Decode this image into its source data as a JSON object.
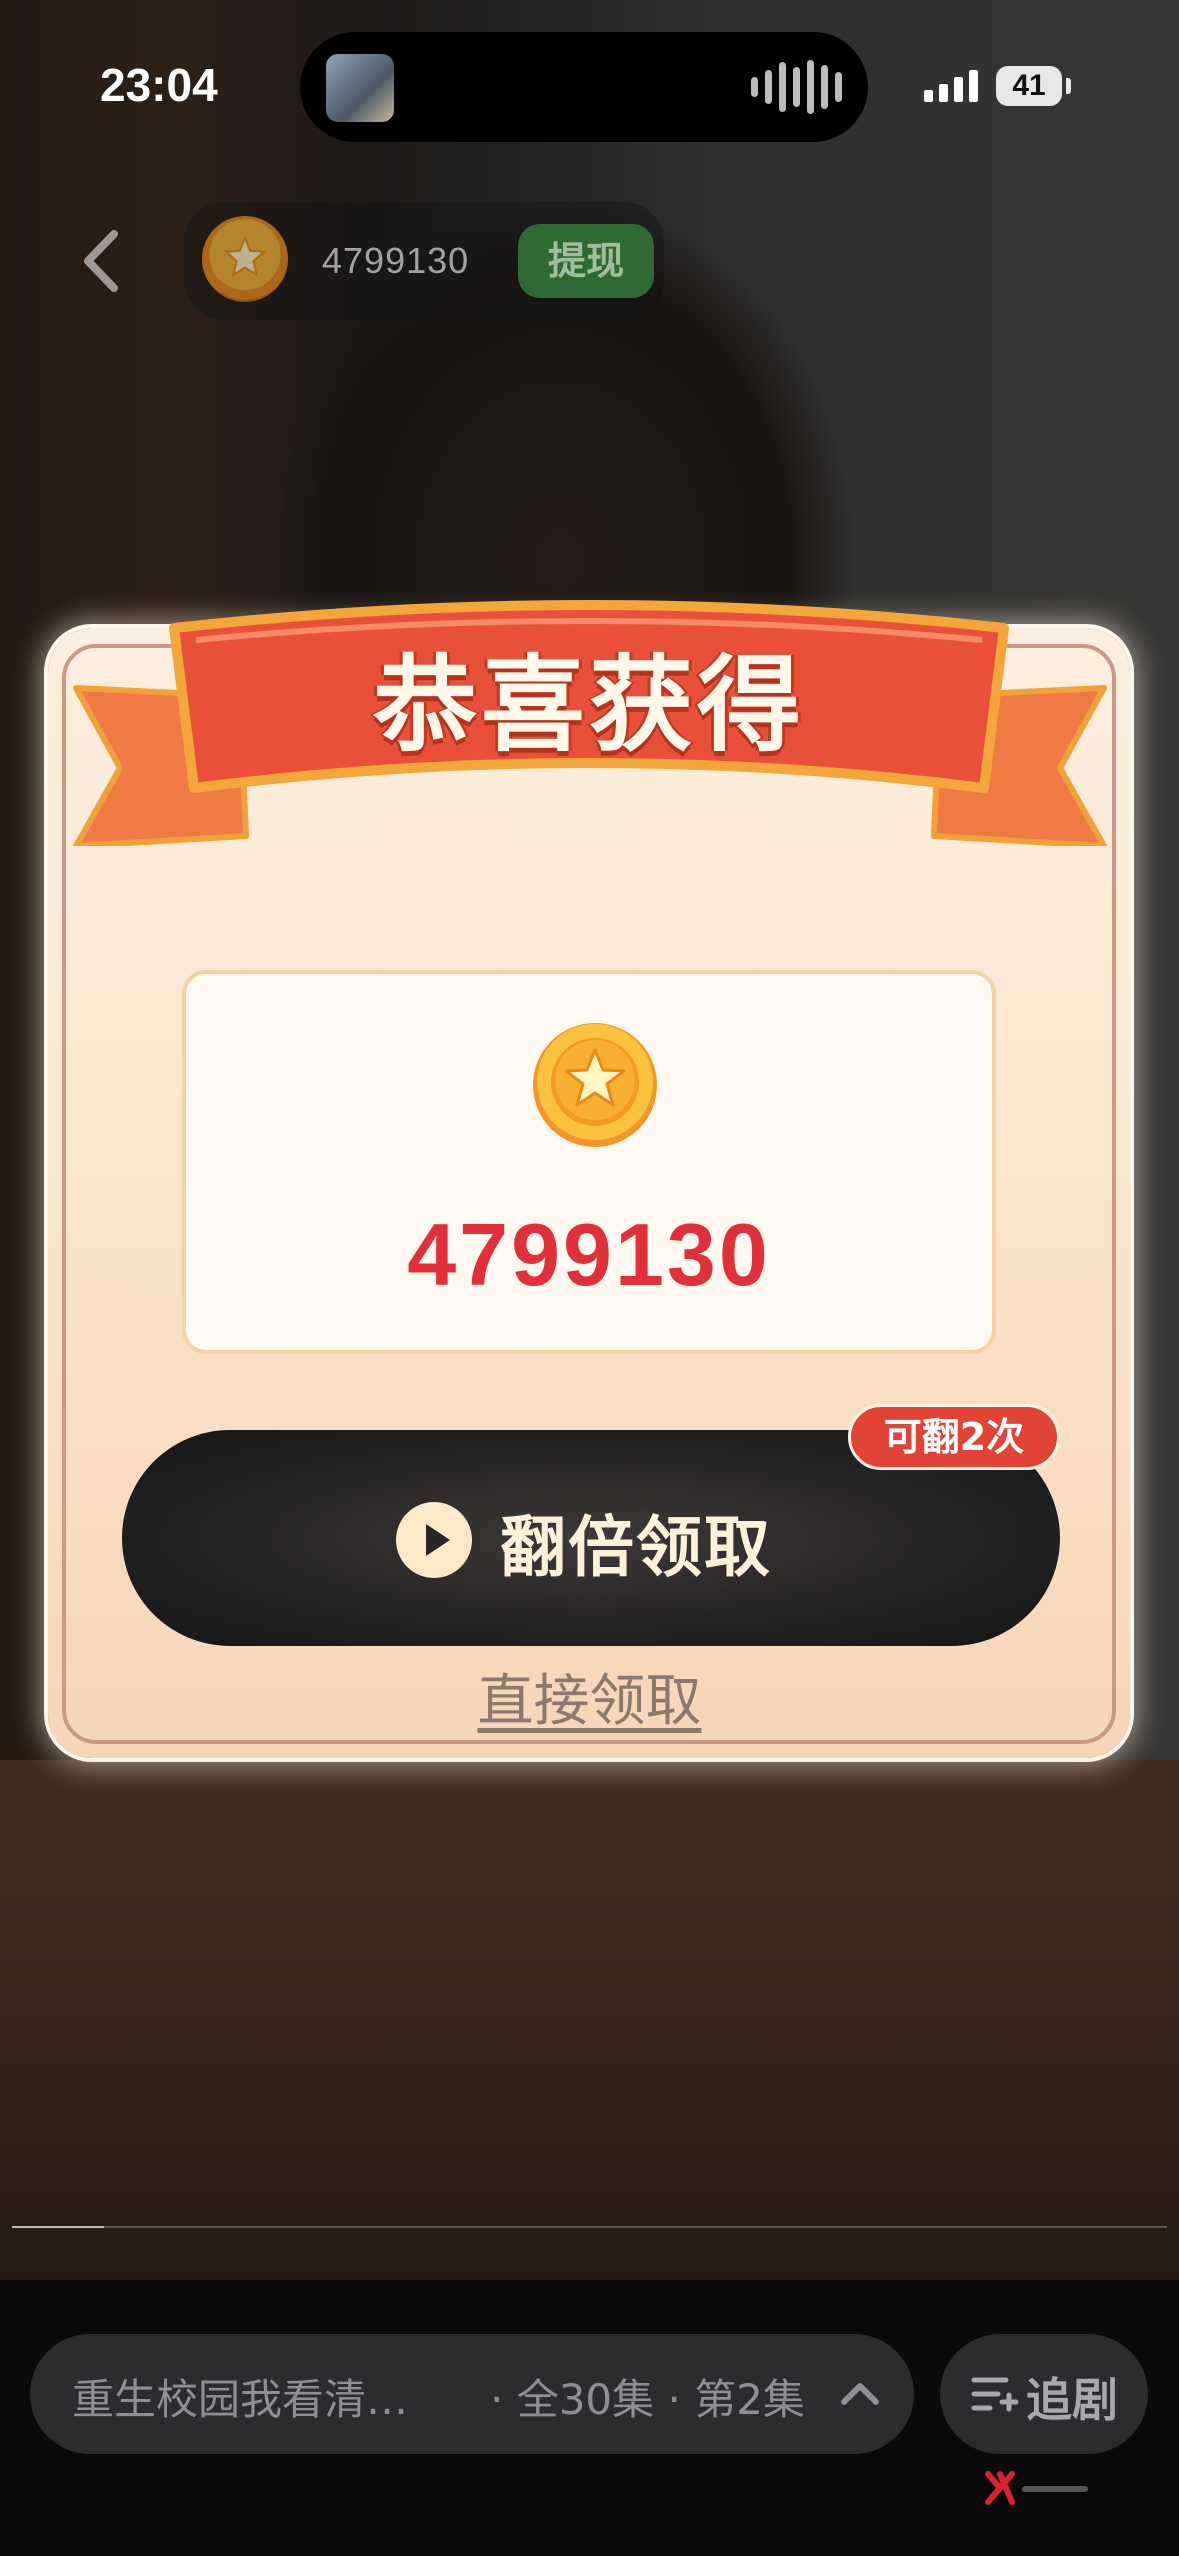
{
  "status_bar": {
    "time": "23:04",
    "battery": "41"
  },
  "header": {
    "coin_balance": "4799130",
    "withdraw_label": "提现"
  },
  "reward_popup": {
    "title": "恭喜获得",
    "amount": "4799130",
    "double_button_label": "翻倍领取",
    "flip_badge": "可翻2次",
    "direct_claim_label": "直接领取"
  },
  "bottom_bar": {
    "drama_title": "重生校园我看清…",
    "drama_meta": "· 全30集 · 第2集",
    "follow_label": "追剧"
  },
  "colors": {
    "amount_red": "#e0303a",
    "ribbon_red": "#e8503a",
    "button_dark": "#242222"
  }
}
